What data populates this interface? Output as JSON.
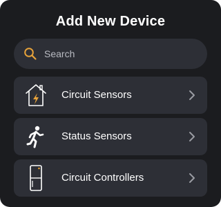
{
  "header": {
    "title": "Add New Device"
  },
  "search": {
    "placeholder": "Search",
    "value": "",
    "icon": "search-icon",
    "icon_color": "#e8a33a"
  },
  "devices": [
    {
      "label": "Circuit Sensors",
      "icon": "house-bolt-icon"
    },
    {
      "label": "Status Sensors",
      "icon": "running-person-icon"
    },
    {
      "label": "Circuit Controllers",
      "icon": "controller-device-icon"
    }
  ],
  "colors": {
    "background": "#1b1c1f",
    "card": "#2d2f36",
    "accent": "#e8a33a",
    "text": "#ffffff",
    "chevron": "#9a9ca3"
  }
}
